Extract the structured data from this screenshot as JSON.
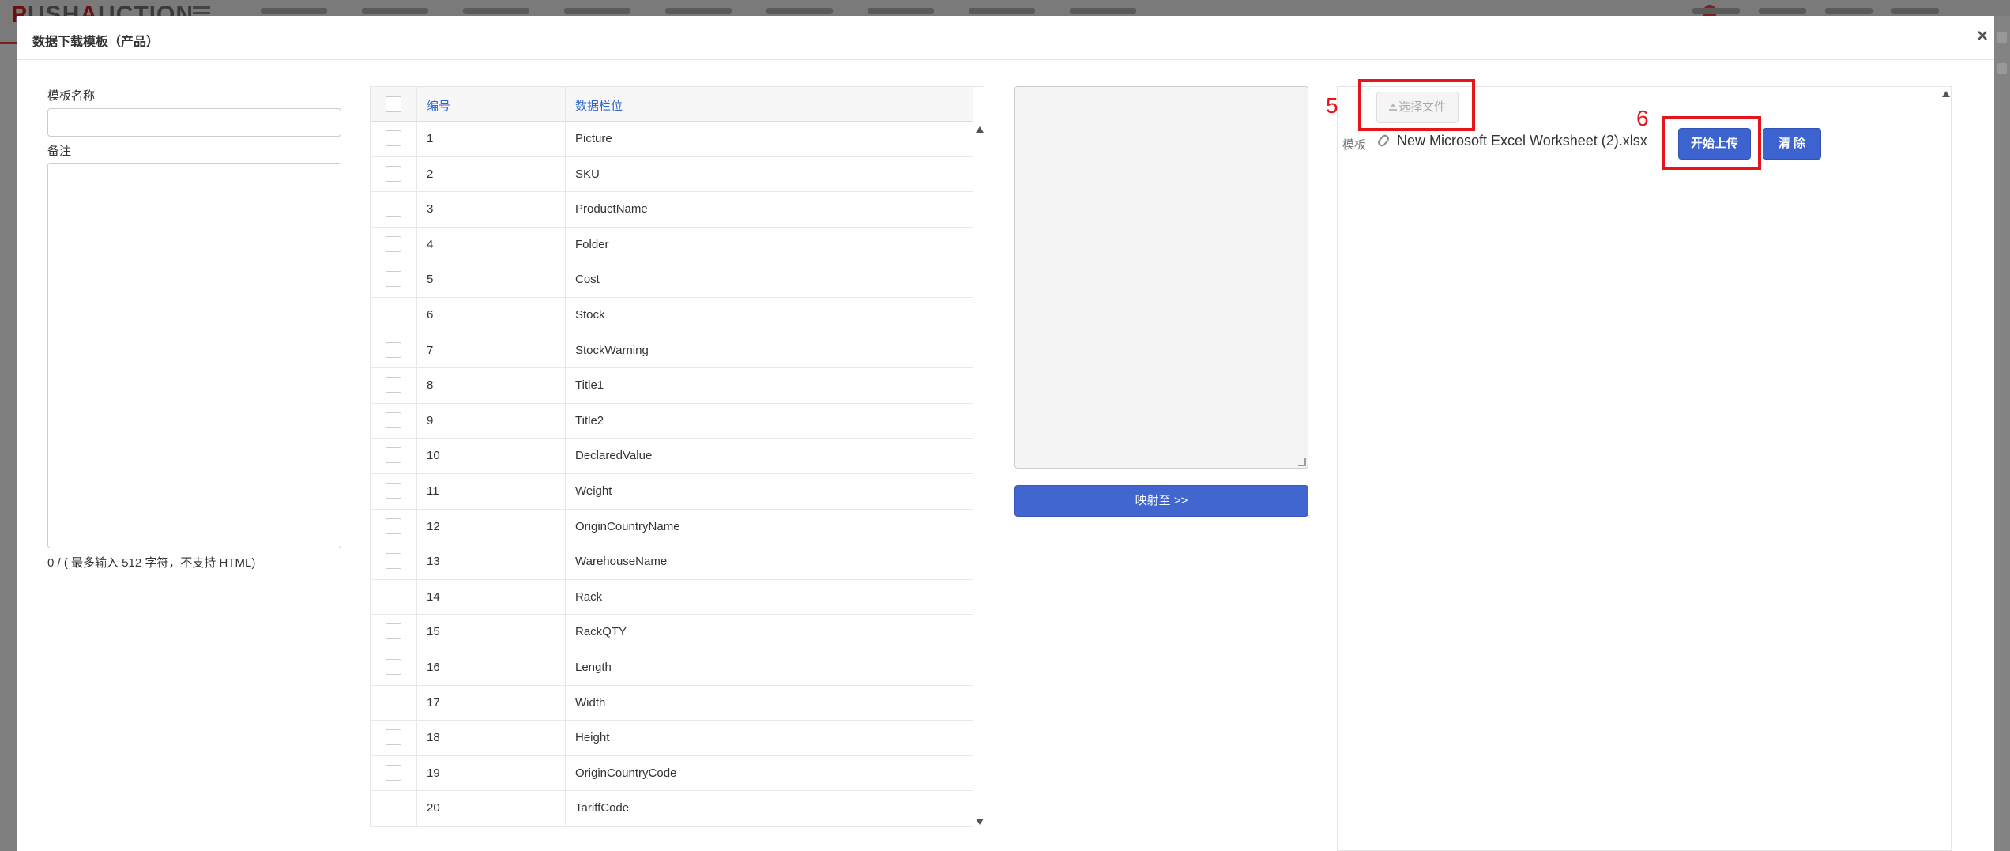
{
  "modal": {
    "title": "数据下载模板（产品）",
    "close_symbol": "×"
  },
  "form": {
    "template_name_label": "模板名称",
    "template_name_value": "",
    "note_label": "备注",
    "note_value": "",
    "char_count": "0 / ( 最多输入 512 字符，不支持 HTML)"
  },
  "table": {
    "headers": {
      "number": "编号",
      "field": "数据栏位"
    },
    "rows": [
      {
        "num": "1",
        "field": "Picture"
      },
      {
        "num": "2",
        "field": "SKU"
      },
      {
        "num": "3",
        "field": "ProductName"
      },
      {
        "num": "4",
        "field": "Folder"
      },
      {
        "num": "5",
        "field": "Cost"
      },
      {
        "num": "6",
        "field": "Stock"
      },
      {
        "num": "7",
        "field": "StockWarning"
      },
      {
        "num": "8",
        "field": "Title1"
      },
      {
        "num": "9",
        "field": "Title2"
      },
      {
        "num": "10",
        "field": "DeclaredValue"
      },
      {
        "num": "11",
        "field": "Weight"
      },
      {
        "num": "12",
        "field": "OriginCountryName"
      },
      {
        "num": "13",
        "field": "WarehouseName"
      },
      {
        "num": "14",
        "field": "Rack"
      },
      {
        "num": "15",
        "field": "RackQTY"
      },
      {
        "num": "16",
        "field": "Length"
      },
      {
        "num": "17",
        "field": "Width"
      },
      {
        "num": "18",
        "field": "Height"
      },
      {
        "num": "19",
        "field": "OriginCountryCode"
      },
      {
        "num": "20",
        "field": "TariffCode"
      }
    ]
  },
  "mapping": {
    "button_label": "映射至 >>"
  },
  "upload": {
    "choose_file_label": "选择文件",
    "template_label": "模板",
    "file_name": "New Microsoft Excel Worksheet (2).xlsx",
    "start_upload_label": "开始上传",
    "clear_label": "清 除"
  },
  "annotations": {
    "step5": "5",
    "step6": "6",
    "color": "#e8141b"
  },
  "colors": {
    "primary_button": "#3c63cf",
    "header_link": "#3366cc"
  }
}
